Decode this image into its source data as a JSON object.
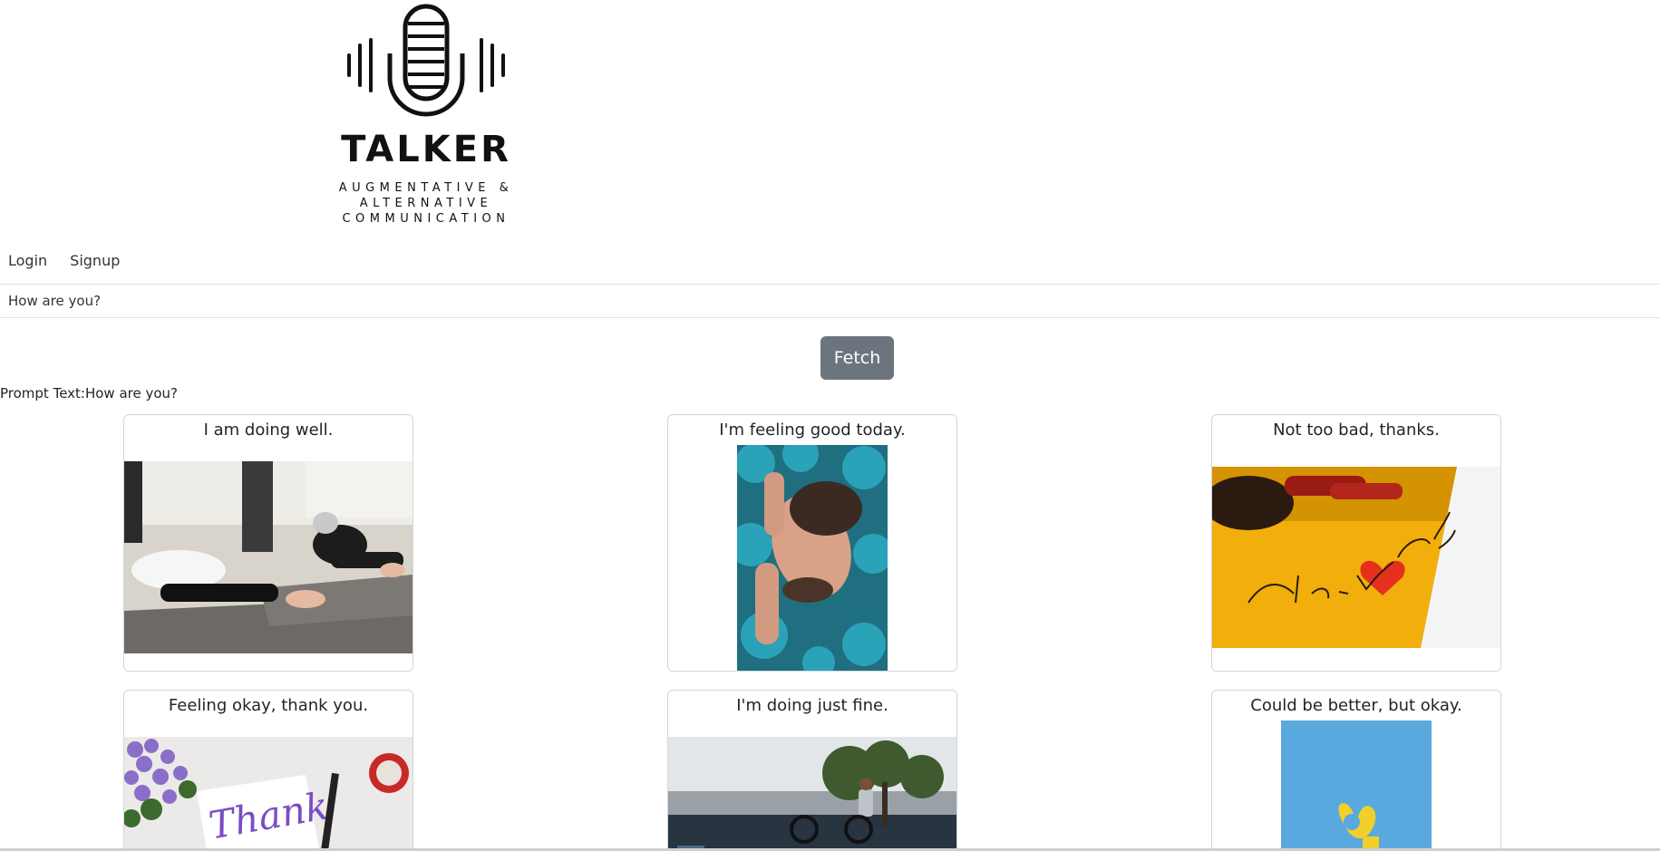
{
  "logo": {
    "brand": "TALKER",
    "tagline": "AUGMENTATIVE & ALTERNATIVE COMMUNICATION",
    "icon": "microphone-soundwave-icon"
  },
  "nav": {
    "login": "Login",
    "signup": "Signup"
  },
  "prompt_input": {
    "value": "How are you?"
  },
  "fetch_button": {
    "label": "Fetch"
  },
  "prompt_text": "Prompt Text:How are you?",
  "cards": [
    {
      "title": "I am doing well.",
      "image": "photo-two-women-stretching-yoga"
    },
    {
      "title": "I'm feeling good today.",
      "image": "photo-man-face-blue-flowers"
    },
    {
      "title": "Not too bad, thanks.",
      "image": "photo-thank-you-note-heart-yellow"
    },
    {
      "title": "Feeling okay, thank you.",
      "image": "photo-thank-you-card-purple-flowers"
    },
    {
      "title": "I'm doing just fine.",
      "image": "photo-bmx-rider-park"
    },
    {
      "title": "Could be better, but okay.",
      "image": "photo-yellow-ok-hand-blue-sky"
    }
  ],
  "colors": {
    "fetch_button": "#6c757d",
    "text": "#212529"
  }
}
